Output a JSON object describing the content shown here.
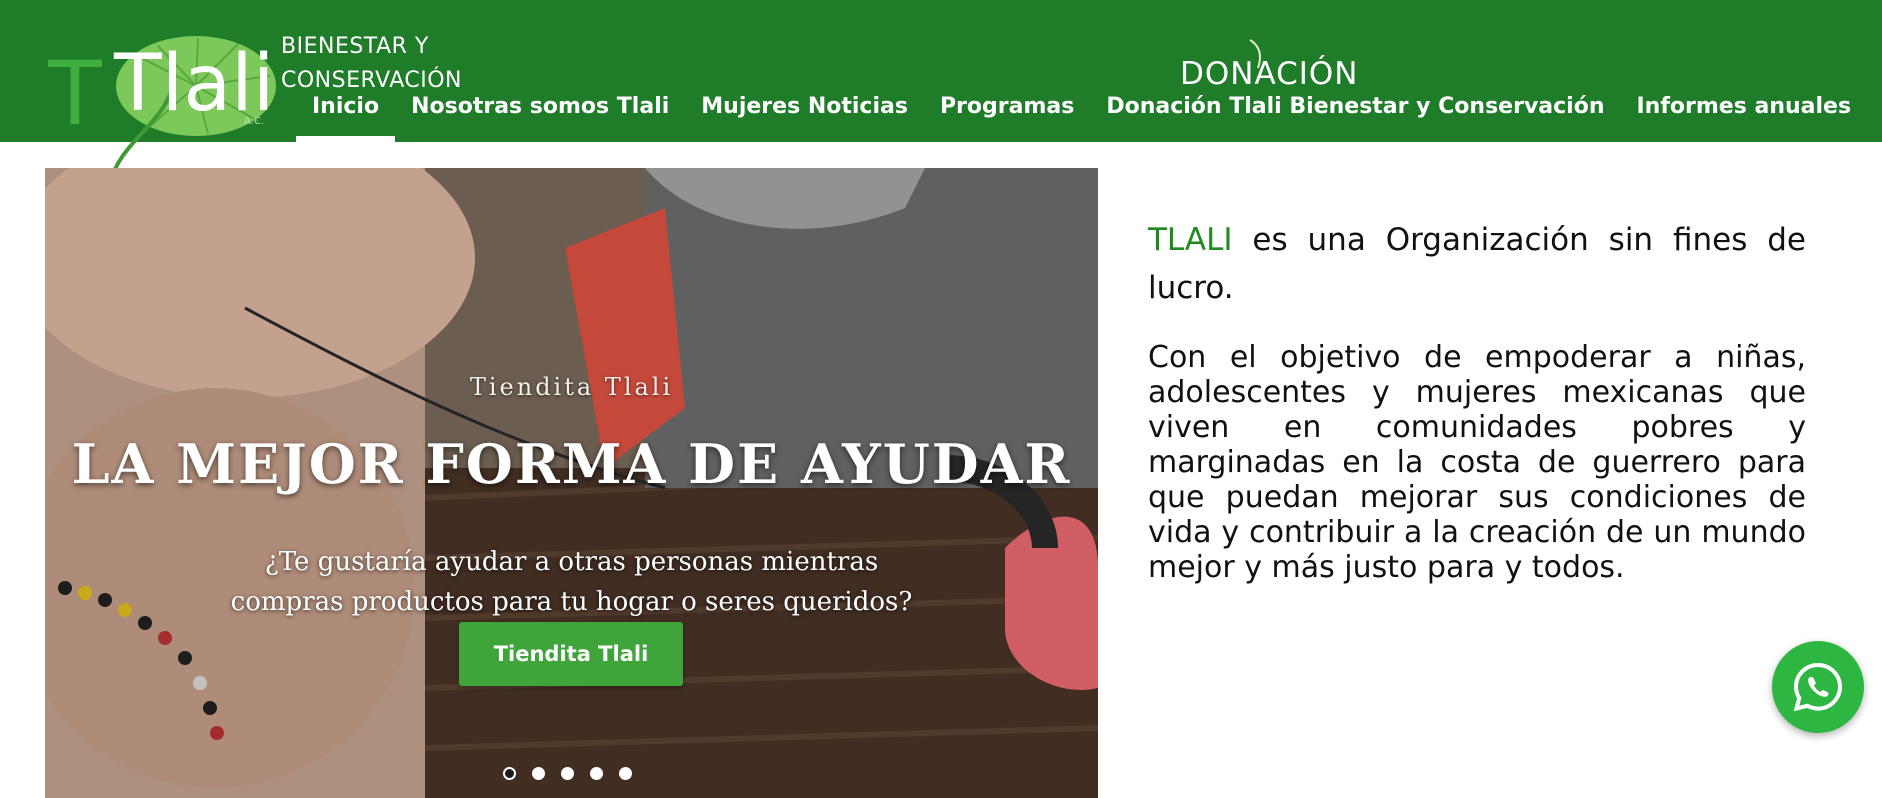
{
  "header": {
    "logo_text": "Tlali",
    "logo_suffix": "A.C.",
    "brand_line1": "BIENESTAR Y",
    "brand_line2": "CONSERVACIÓN",
    "donation_badge": "DONACIÓN",
    "bg_color": "#1f7d2a"
  },
  "nav": {
    "items": [
      {
        "label": "Inicio",
        "active": true
      },
      {
        "label": "Nosotras somos Tlali"
      },
      {
        "label": "Mujeres Noticias"
      },
      {
        "label": "Programas"
      },
      {
        "label": "Donación Tlali Bienestar y Conservación"
      },
      {
        "label": "Informes anuales"
      }
    ]
  },
  "hero": {
    "subtitle": "Tiendita Tlali",
    "title": "LA MEJOR FORMA DE AYUDAR",
    "question_line1": "¿Te gustaría ayudar a otras personas mientras",
    "question_line2": "compras productos para tu hogar o seres queridos?",
    "button_label": "Tiendita Tlali",
    "button_color": "#3fa53a",
    "slide_count": 5,
    "active_slide": 1
  },
  "intro": {
    "brand": "TLALI",
    "text": " es una Organización sin fines de lucro.",
    "brand_color": "#1f8a1f"
  },
  "mission": {
    "text": "Con el objetivo de empoderar a niñas, adolescentes y mujeres mexicanas que viven en comunidades pobres y marginadas en la costa de guerrero para que puedan mejorar sus condiciones de vida y contribuir a la creación de un mundo mejor y más justo para y todos."
  },
  "whatsapp": {
    "icon": "whatsapp-icon",
    "color": "#2db742"
  }
}
